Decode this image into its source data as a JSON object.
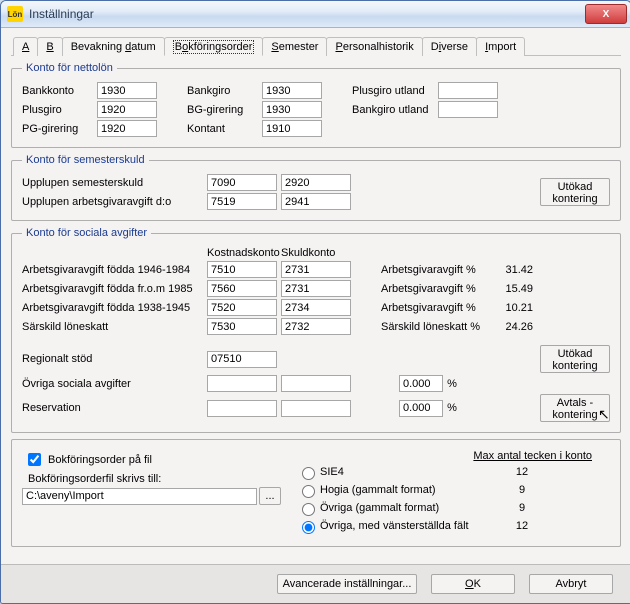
{
  "titlebar": {
    "icon_text": "Lön",
    "title": "Inställningar",
    "close": "X"
  },
  "tabs": {
    "t0": "Allmänt",
    "t1": "Bank",
    "t2": "Bevakning datum",
    "t3": "Bokföringsorder",
    "t4": "Semester",
    "t5": "Personalhistorik",
    "t6": "Diverse",
    "t7": "Import"
  },
  "g1": {
    "legend": "Konto för nettolön",
    "bankkonto_label": "Bankkonto",
    "bankkonto": "1930",
    "plusgiro_label": "Plusgiro",
    "plusgiro": "1920",
    "pggir_label": "PG-girering",
    "pggir": "1920",
    "bankgiro_label": "Bankgiro",
    "bankgiro": "1930",
    "bggir_label": "BG-girering",
    "bggir": "1930",
    "kontant_label": "Kontant",
    "kontant": "1910",
    "plusgiro_utl_label": "Plusgiro utland",
    "plusgiro_utl": "",
    "bankgiro_utl_label": "Bankgiro utland",
    "bankgiro_utl": ""
  },
  "g2": {
    "legend": "Konto för semesterskuld",
    "upplsem_label": "Upplupen semesterskuld",
    "upplsem_a": "7090",
    "upplsem_b": "2920",
    "upplarb_label": "Upplupen arbetsgivaravgift d:o",
    "upplarb_a": "7519",
    "upplarb_b": "2941",
    "utokad_btn": "Utökad\nkontering"
  },
  "g3": {
    "legend": "Konto för sociala avgifter",
    "h_kost": "Kostnadskonto",
    "h_skuld": "Skuldkonto",
    "r1_label": "Arbetsgivaravgift födda 1946-1984",
    "r1_a": "7510",
    "r1_b": "2731",
    "r2_label": "Arbetsgivaravgift födda fr.o.m 1985",
    "r2_a": "7560",
    "r2_b": "2731",
    "r3_label": "Arbetsgivaravgift födda 1938-1945",
    "r3_a": "7520",
    "r3_b": "2734",
    "r4_label": "Särskild löneskatt",
    "r4_a": "7530",
    "r4_b": "2732",
    "p1_label": "Arbetsgivaravgift %",
    "p1": "31.42",
    "p2_label": "Arbetsgivaravgift %",
    "p2": "15.49",
    "p3_label": "Arbetsgivaravgift %",
    "p3": "10.21",
    "p4_label": "Särskild löneskatt %",
    "p4": "24.26",
    "reg_label": "Regionalt stöd",
    "reg": "07510",
    "ovr_label": "Övriga sociala avgifter",
    "ovr_a": "",
    "ovr_b": "",
    "ovr_pct": "0.000",
    "pct_sign": "%",
    "res_label": "Reservation",
    "res_a": "",
    "res_b": "",
    "res_pct": "0.000",
    "utokad_btn": "Utökad\nkontering",
    "avtals_btn": "Avtals -\nkontering"
  },
  "g4": {
    "chk_label": "Bokföringsorder på fil",
    "filepath_label": "Bokföringsorderfil skrivs till:",
    "filepath": "C:\\aveny\\Import",
    "browse": "...",
    "max_label": "Max antal tecken i konto",
    "o1": "SIE4",
    "o1v": "12",
    "o2": "Hogia (gammalt format)",
    "o2v": "9",
    "o3": "Övriga (gammalt format)",
    "o3v": "9",
    "o4": "Övriga, med vänsterställda fält",
    "o4v": "12"
  },
  "bottom": {
    "adv": "Avancerade inställningar...",
    "ok": "OK",
    "cancel": "Avbryt"
  }
}
